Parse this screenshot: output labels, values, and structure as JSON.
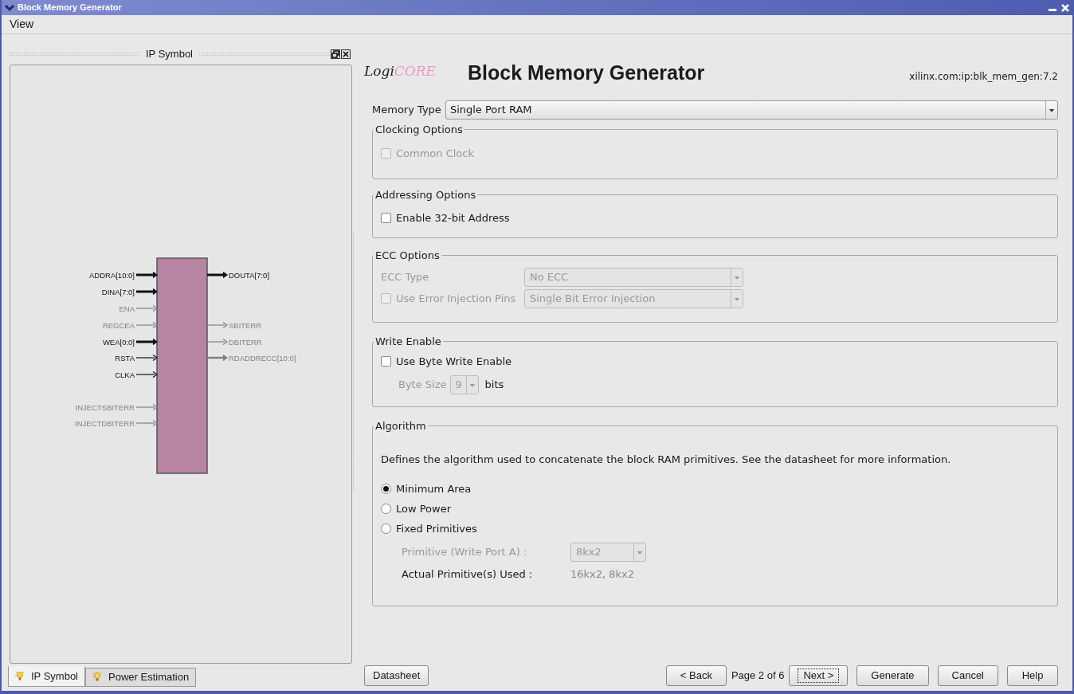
{
  "window": {
    "title": "Block Memory Generator"
  },
  "menu": [
    {
      "label": "View"
    }
  ],
  "left_panel": {
    "title": "IP Symbol",
    "left_pins": [
      {
        "label": "ADDRA[10:0]",
        "enabled": true,
        "bus": true
      },
      {
        "label": "DINA[7:0]",
        "enabled": true,
        "bus": true
      },
      {
        "label": "ENA",
        "enabled": false,
        "bus": false
      },
      {
        "label": "REGCEA",
        "enabled": false,
        "bus": false
      },
      {
        "label": "WEA[0:0]",
        "enabled": true,
        "bus": true
      },
      {
        "label": "RSTA",
        "enabled": true,
        "bus": false
      },
      {
        "label": "CLKA",
        "enabled": true,
        "bus": false
      },
      {
        "label": "INJECTSBITERR",
        "enabled": false,
        "bus": false
      },
      {
        "label": "INJECTDBITERR",
        "enabled": false,
        "bus": false
      }
    ],
    "right_pins": [
      {
        "label": "DOUTA[7:0]",
        "enabled": true,
        "bus": true
      },
      {
        "label": "SBITERR",
        "enabled": false,
        "bus": false
      },
      {
        "label": "DBITERR",
        "enabled": false,
        "bus": false
      },
      {
        "label": "RDADDRECC[10:0]",
        "enabled": false,
        "bus": true
      }
    ],
    "tabs": [
      {
        "label": "IP Symbol",
        "selected": true
      },
      {
        "label": "Power Estimation",
        "selected": false
      }
    ]
  },
  "header": {
    "logo_prefix": "Logi",
    "logo_suffix": "CORE",
    "title": "Block Memory Generator",
    "version": "xilinx.com:ip:blk_mem_gen:7.2"
  },
  "memory_type": {
    "label": "Memory Type",
    "value": "Single Port RAM"
  },
  "clocking": {
    "title": "Clocking Options",
    "common_clock": {
      "label": "Common Clock",
      "checked": false,
      "disabled": true
    }
  },
  "addressing": {
    "title": "Addressing Options",
    "address_32": {
      "label": "Enable 32-bit Address",
      "checked": false,
      "disabled": false
    }
  },
  "ecc": {
    "title": "ECC Options",
    "type_label": "ECC Type",
    "type_value": "No ECC",
    "injection": {
      "label": "Use Error Injection Pins",
      "checked": false,
      "disabled": true
    },
    "injection_value": "Single Bit Error Injection",
    "disabled": true
  },
  "write_enable": {
    "title": "Write Enable",
    "byte_write": {
      "label": "Use Byte Write Enable",
      "checked": false,
      "disabled": false
    },
    "byte_size_label": "Byte Size",
    "byte_size_value": "9",
    "byte_size_unit": "bits",
    "byte_size_disabled": true
  },
  "algorithm": {
    "title": "Algorithm",
    "description": "Defines the algorithm used to concatenate the block RAM primitives.  See the datasheet for more information.",
    "options": [
      {
        "label": "Minimum Area",
        "selected": true
      },
      {
        "label": "Low Power",
        "selected": false
      },
      {
        "label": "Fixed Primitives",
        "selected": false
      }
    ],
    "primitive_label": "Primitive (Write Port A) :",
    "primitive_value": "8kx2",
    "primitive_disabled": true,
    "actual_label": "Actual Primitive(s) Used :",
    "actual_value": "16kx2, 8kx2"
  },
  "buttons": {
    "datasheet": "Datasheet",
    "nav": [
      {
        "label": "< Back",
        "kind": "button",
        "focused": false
      },
      {
        "label": "Page 2 of 6",
        "kind": "text"
      },
      {
        "label": "Next >",
        "kind": "button",
        "focused": true
      },
      {
        "label": "Generate",
        "kind": "button",
        "focused": false
      },
      {
        "label": "Cancel",
        "kind": "button",
        "focused": false
      },
      {
        "label": "Help",
        "kind": "button",
        "focused": false
      }
    ]
  }
}
